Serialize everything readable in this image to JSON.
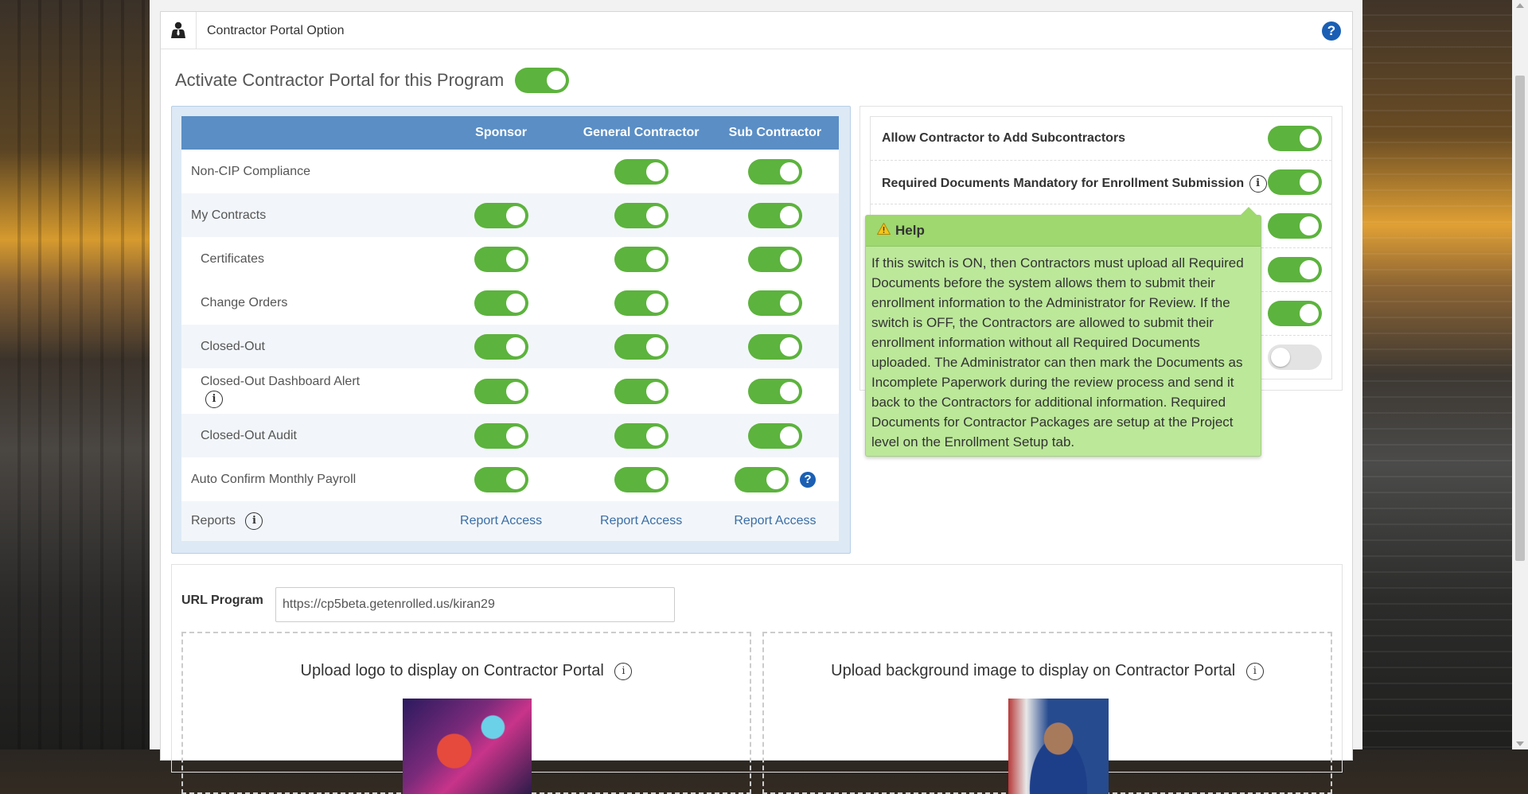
{
  "header": {
    "title": "Contractor Portal Option",
    "help": "?"
  },
  "activate": {
    "label": "Activate Contractor Portal for this Program",
    "on": true
  },
  "matrix": {
    "columns": [
      "Sponsor",
      "General Contractor",
      "Sub Contractor"
    ],
    "rows": [
      {
        "label": "Non-CIP Compliance"
      },
      {
        "label": "My Contracts"
      },
      {
        "label": "Certificates"
      },
      {
        "label": "Change Orders"
      },
      {
        "label": "Closed-Out"
      },
      {
        "label": "Closed-Out Dashboard Alert"
      },
      {
        "label": "Closed-Out Audit"
      },
      {
        "label": "Auto Confirm Monthly Payroll"
      },
      {
        "label": "Reports"
      }
    ],
    "report_access": "Report Access"
  },
  "options": [
    {
      "label": "Allow Contractor to Add Subcontractors",
      "on": true
    },
    {
      "label": "Required Documents Mandatory for Enrollment Submission",
      "on": true
    },
    {
      "label": "",
      "on": true
    },
    {
      "label": "",
      "on": true
    },
    {
      "label": "",
      "on": true
    },
    {
      "label": "",
      "on": false
    }
  ],
  "popover": {
    "title": "Help",
    "body": "If this switch is ON, then Contractors must upload all Required Documents before the system allows them to submit their enrollment information to the Administrator for Review. If the switch is OFF, the Contractors are allowed to submit their enrollment information without all Required Documents uploaded. The Administrator can then mark the Documents as Incomplete Paperwork during the review process and send it back to the Contractors for additional information. Required Documents for Contractor Packages are setup at the Project level on the Enrollment Setup tab."
  },
  "url": {
    "label": "URL Program",
    "value": "https://cp5beta.getenrolled.us/kiran29"
  },
  "uploads": {
    "logo_title": "Upload logo to display on Contractor Portal",
    "background_title": "Upload background image to display on Contractor Portal"
  },
  "icons": {
    "info": "i",
    "warning": "⚠"
  },
  "colors": {
    "toggle_on": "#5cb33d",
    "header_blue": "#5a8ec5",
    "help_blue": "#1a5fb4",
    "popover_green": "#bce89a"
  }
}
